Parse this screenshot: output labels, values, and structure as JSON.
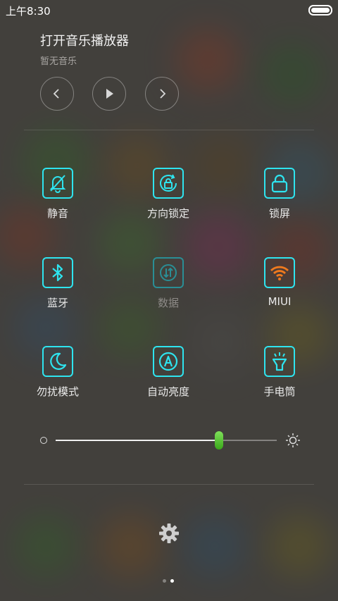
{
  "status_bar": {
    "time": "上午8:30"
  },
  "music": {
    "title": "打开音乐播放器",
    "subtitle": "暂无音乐"
  },
  "toggles": [
    {
      "label": "静音",
      "icon": "silent-bell-icon",
      "state": "on"
    },
    {
      "label": "方向锁定",
      "icon": "rotation-lock-icon",
      "state": "on"
    },
    {
      "label": "锁屏",
      "icon": "lock-icon",
      "state": "on"
    },
    {
      "label": "蓝牙",
      "icon": "bluetooth-icon",
      "state": "on"
    },
    {
      "label": "数据",
      "icon": "mobile-data-icon",
      "state": "off"
    },
    {
      "label": "MIUI",
      "icon": "wifi-icon",
      "state": "on"
    },
    {
      "label": "勿扰模式",
      "icon": "moon-icon",
      "state": "on"
    },
    {
      "label": "自动亮度",
      "icon": "auto-brightness-icon",
      "state": "on"
    },
    {
      "label": "手电筒",
      "icon": "flashlight-icon",
      "state": "on"
    }
  ],
  "brightness": {
    "level": 0.74
  },
  "pager": {
    "count": 2,
    "active": 1
  },
  "colors": {
    "accent": "#2ee4ef",
    "wifi_active": "#f07a1e",
    "slider_thumb": "#4cc22a"
  }
}
